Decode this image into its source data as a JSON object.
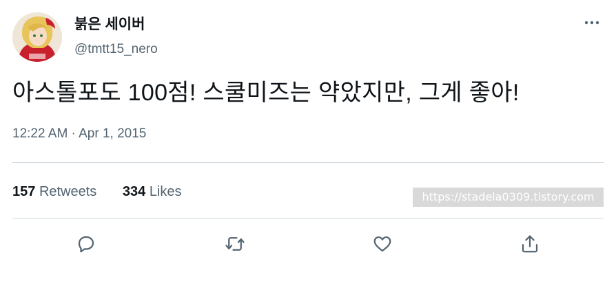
{
  "user": {
    "display_name": "붉은 세이버",
    "handle": "@tmtt15_nero"
  },
  "tweet": {
    "text": "아스톨포도 100점! 스쿨미즈는 약았지만, 그게 좋아!",
    "timestamp": "12:22 AM · Apr 1, 2015"
  },
  "stats": {
    "retweets_count": "157",
    "retweets_label": "Retweets",
    "likes_count": "334",
    "likes_label": "Likes"
  },
  "watermark": "https://stadela0309.tistory.com",
  "icons": {
    "more": "more-icon",
    "reply": "reply-icon",
    "retweet": "retweet-icon",
    "like": "heart-icon",
    "share": "share-icon"
  },
  "colors": {
    "text": "#0f1419",
    "secondary": "#536471",
    "divider": "#cfd9de"
  }
}
